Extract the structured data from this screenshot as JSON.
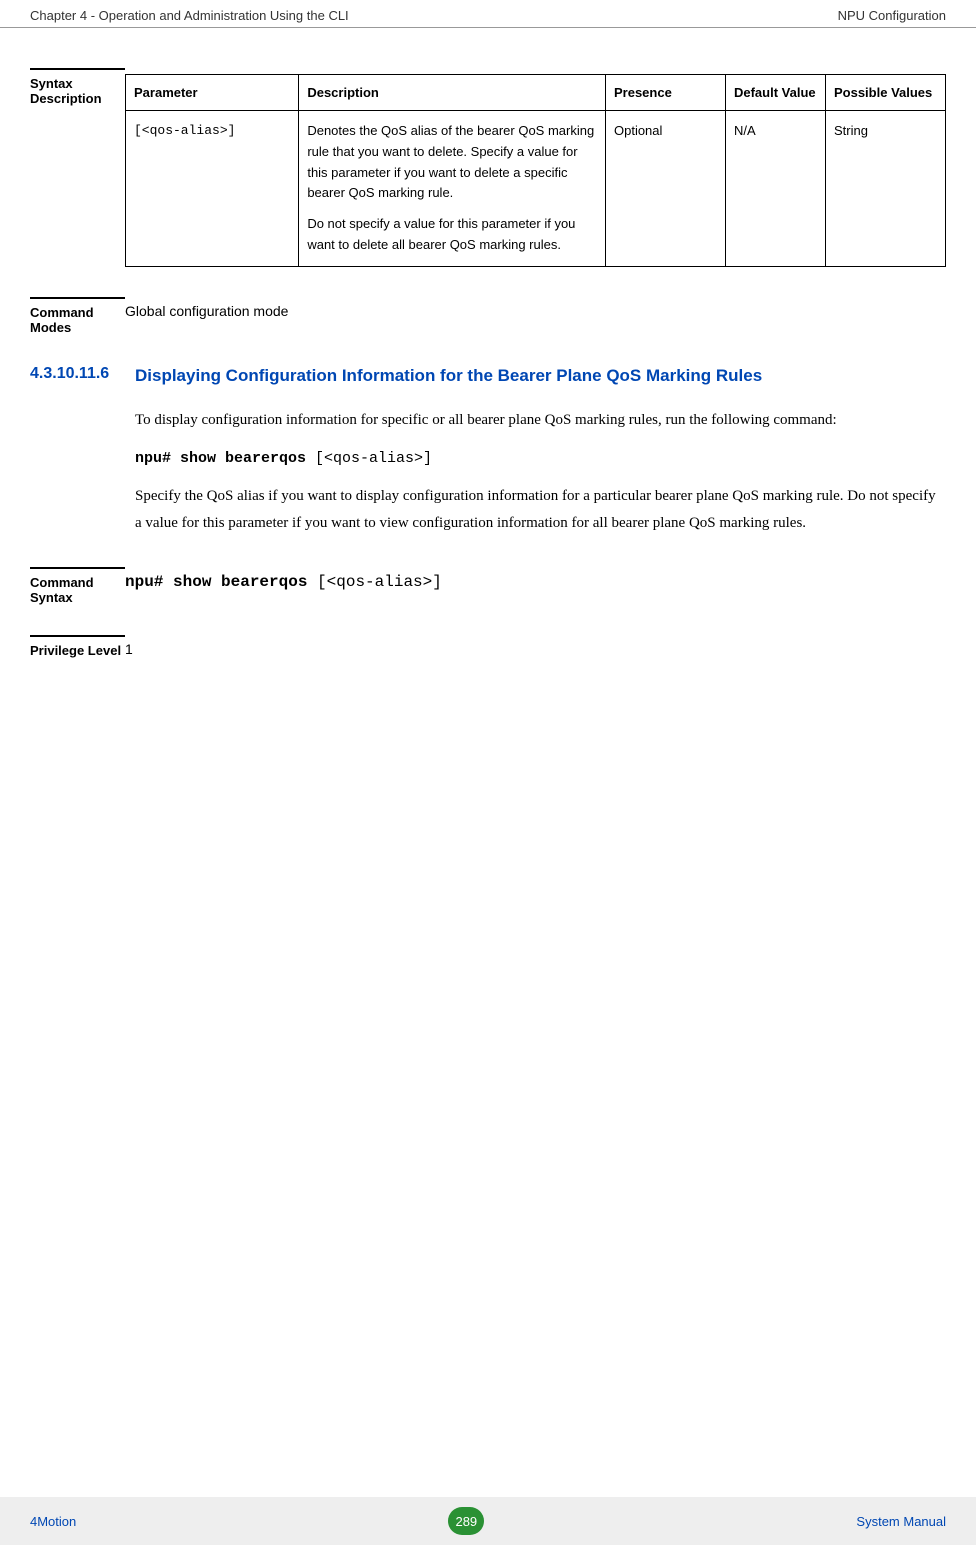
{
  "header": {
    "left": "Chapter 4 - Operation and Administration Using the CLI",
    "right": "NPU Configuration"
  },
  "syntax": {
    "label": "Syntax Description",
    "headers": {
      "param": "Parameter",
      "desc": "Description",
      "presence": "Presence",
      "defval": "Default Value",
      "possible": "Possible Values"
    },
    "row": {
      "param": "[<qos-alias>]",
      "desc_p1": "Denotes the QoS alias of the bearer QoS marking rule that you want to delete. Specify a value for this parameter if you want to delete a specific bearer QoS marking rule.",
      "desc_p2": "Do not specify a value for this parameter if you want to delete all bearer QoS marking rules.",
      "presence": "Optional",
      "defval": "N/A",
      "possible": "String"
    }
  },
  "command_modes": {
    "label": "Command Modes",
    "text": "Global configuration mode"
  },
  "subsection": {
    "num": "4.3.10.11.6",
    "title": "Displaying Configuration Information for the Bearer Plane QoS Marking Rules",
    "para1": " To display configuration information for specific or all bearer plane QoS marking rules, run the following command:",
    "cmd_bold": "npu# show bearerqos ",
    "cmd_rest": "[<qos-alias>]",
    "para2": "Specify the QoS alias if you want to display configuration information for a particular bearer plane QoS marking rule. Do not specify a value for this parameter if you want to view configuration information for all bearer plane QoS marking rules."
  },
  "command_syntax": {
    "label": "Command Syntax",
    "cmd_bold": "npu# show bearerqos ",
    "cmd_rest": "[<qos-alias>]"
  },
  "privilege": {
    "label": "Privilege Level",
    "text": "1"
  },
  "footer": {
    "left": "4Motion",
    "page": "289",
    "right": "System Manual"
  }
}
